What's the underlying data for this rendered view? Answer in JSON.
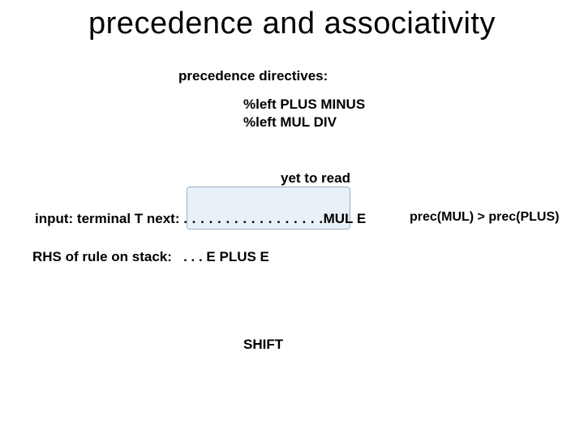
{
  "title": "precedence and associativity",
  "subtitle": "precedence directives:",
  "directives_line1": "%left PLUS MINUS",
  "directives_line2": "%left MUL DIV",
  "yet_label": "yet to read",
  "input_label": "input: terminal T next: ",
  "input_dots": ". . . . . . . . . . . . . . . . .",
  "input_tail": "MUL E",
  "prec_compare": "prec(MUL) > prec(PLUS)",
  "rhs_label": "RHS of rule on stack:   . . . E PLUS E",
  "shift": "SHIFT"
}
